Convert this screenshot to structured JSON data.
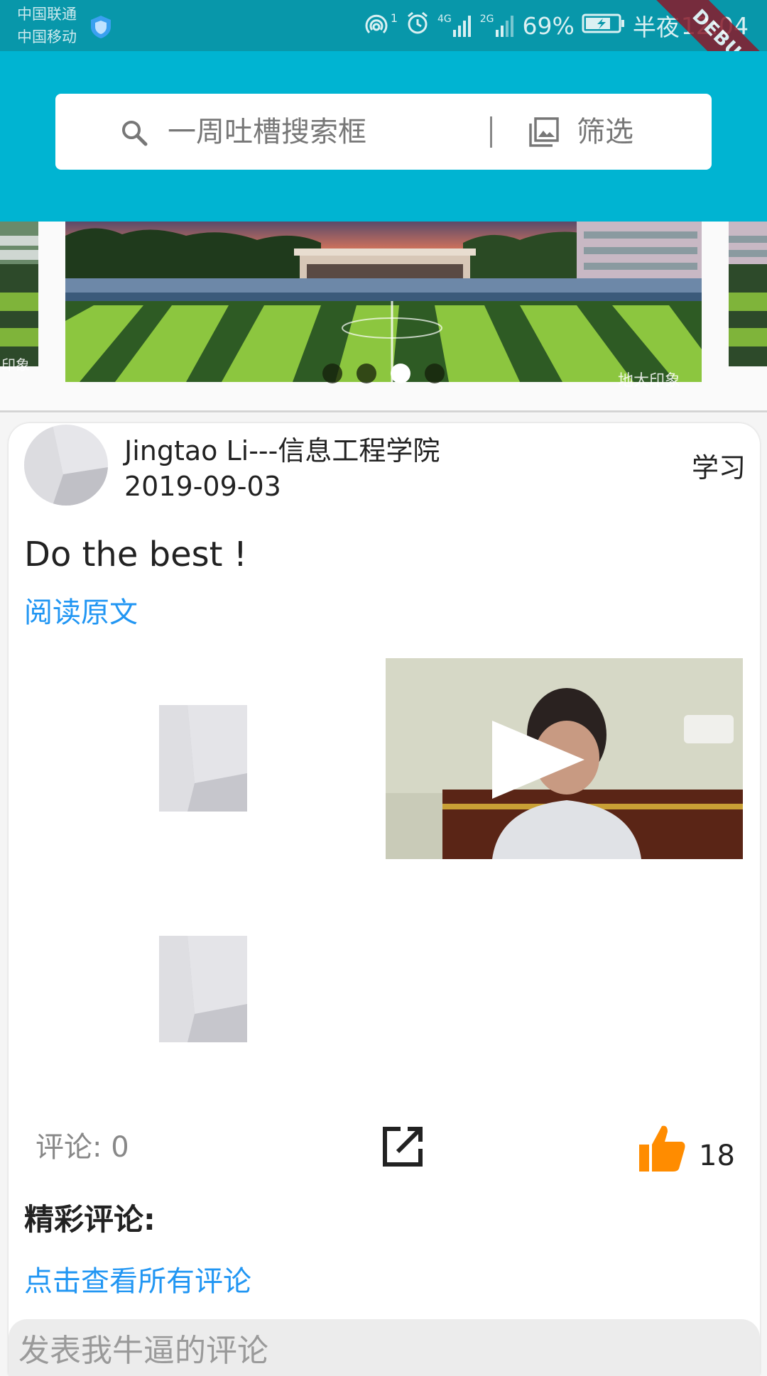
{
  "status_bar": {
    "carrier1": "中国联通",
    "carrier2": "中国移动",
    "battery": "69%",
    "time_period": "半夜",
    "time": "12:04",
    "debug_label": "DEBUG",
    "net1": "4G",
    "net2": "2G",
    "hotspot_sup": "1"
  },
  "header": {
    "search_placeholder": "一周吐槽搜索框",
    "filter_label": "筛选",
    "color": "#00b4d2"
  },
  "banner": {
    "watermark": "地大印象",
    "side_watermark": "印象",
    "active_index": 2,
    "dot_count": 4
  },
  "post": {
    "author": "Jingtao Li---信息工程学院",
    "date": "2019-09-03",
    "category": "学习",
    "text": "Do the best !",
    "read_more": "阅读原文",
    "comments_label": "评论: 0",
    "likes": "18",
    "hot_comments_label": "精彩评论:",
    "view_all_comments": "点击查看所有评论",
    "comment_placeholder": "发表我牛逼的评论"
  },
  "colors": {
    "accent_link": "#2196f3",
    "like": "#ff8c00",
    "status_bar": "#0897aa"
  },
  "icons": {
    "search": "search-icon",
    "filter": "image-filter-icon",
    "share": "open-in-new-icon",
    "like": "thumbs-up-icon",
    "play": "play-icon"
  }
}
